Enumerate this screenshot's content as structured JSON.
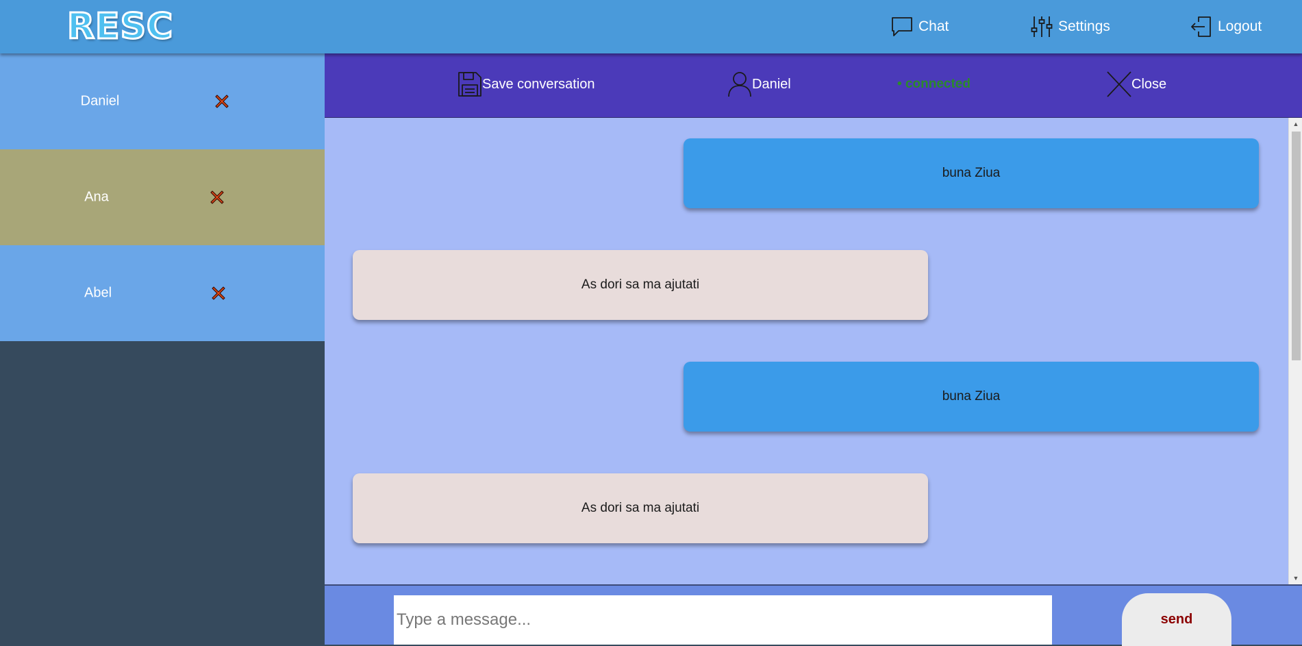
{
  "app": {
    "logo_text": "RESC"
  },
  "nav": {
    "chat_label": "Chat",
    "settings_label": "Settings",
    "logout_label": "Logout"
  },
  "contacts": [
    {
      "name": "Daniel",
      "background": "#6aa6e8"
    },
    {
      "name": "Ana",
      "background": "#a8a678"
    },
    {
      "name": "Abel",
      "background": "#6aa6e8"
    }
  ],
  "chat_header": {
    "save_label": "Save conversation",
    "user_name": "Daniel",
    "status": "• connected",
    "close_label": "Close"
  },
  "messages": [
    {
      "text": "buna Ziua",
      "direction": "sent"
    },
    {
      "text": "As dori sa ma ajutati",
      "direction": "received"
    },
    {
      "text": "buna Ziua",
      "direction": "sent"
    },
    {
      "text": "As dori sa ma ajutati",
      "direction": "received"
    }
  ],
  "composer": {
    "placeholder": "Type a message...",
    "send_label": "send"
  },
  "colors": {
    "topbar": "#4a9ada",
    "sidebar": "#364a5d",
    "chat_header": "#4b3ab9",
    "chat_area": "#a6baf7",
    "sent_bubble": "#3b9be9",
    "received_bubble": "#e8dcdb",
    "composer": "#6a8ae2",
    "status": "#2b8a2b",
    "send_text": "#8b0000",
    "remove_icon": "#e04a1a"
  }
}
